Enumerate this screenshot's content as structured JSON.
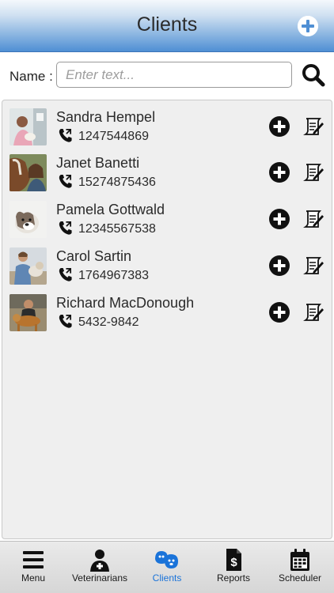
{
  "header": {
    "title": "Clients"
  },
  "search": {
    "label": "Name :",
    "placeholder": "Enter text...",
    "value": ""
  },
  "clients": [
    {
      "name": "Sandra Hempel",
      "phone": "1247544869"
    },
    {
      "name": "Janet Banetti",
      "phone": "15274875436"
    },
    {
      "name": "Pamela Gottwald",
      "phone": "12345567538"
    },
    {
      "name": "Carol Sartin",
      "phone": "1764967383"
    },
    {
      "name": "Richard MacDonough",
      "phone": "5432-9842"
    }
  ],
  "tabs": [
    {
      "label": "Menu",
      "icon": "hamburger-icon"
    },
    {
      "label": "Veterinarians",
      "icon": "doctor-icon"
    },
    {
      "label": "Clients",
      "icon": "paw-clients-icon",
      "active": true
    },
    {
      "label": "Reports",
      "icon": "dollar-document-icon"
    },
    {
      "label": "Scheduler",
      "icon": "calendar-icon"
    }
  ],
  "colors": {
    "header_gradient_end": "#4f8fd4",
    "active_tab": "#1a73d9",
    "list_background": "#efefef"
  }
}
